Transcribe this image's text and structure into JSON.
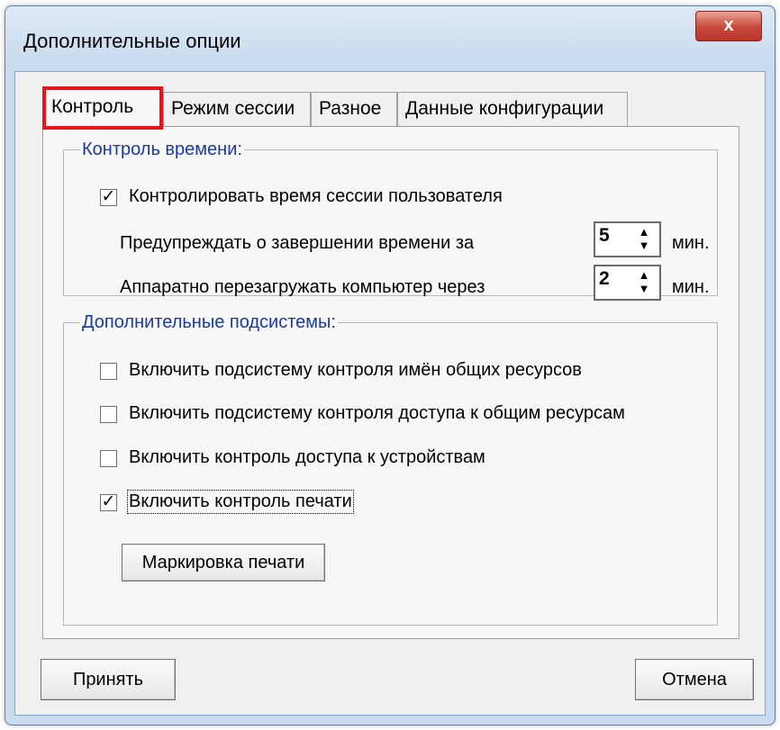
{
  "window": {
    "title": "Дополнительные опции",
    "close_label": "x"
  },
  "tabs": [
    {
      "label": "Контроль",
      "active": true
    },
    {
      "label": "Режим сессии",
      "active": false
    },
    {
      "label": "Разное",
      "active": false
    },
    {
      "label": "Данные конфигурации",
      "active": false
    }
  ],
  "time_control": {
    "legend": "Контроль времени:",
    "monitor_checkbox": {
      "label": "Контролировать время сессии пользователя",
      "checked": true,
      "mark": "✓"
    },
    "warn": {
      "label": "Предупреждать о завершении времени за",
      "value": "5",
      "unit": "мин."
    },
    "reboot": {
      "label": "Аппаратно перезагружать компьютер через",
      "value": "2",
      "unit": "мин."
    }
  },
  "subsystems": {
    "legend": "Дополнительные подсистемы:",
    "items": [
      {
        "label": "Включить подсистему контроля имён общих ресурсов",
        "checked": false,
        "mark": ""
      },
      {
        "label": "Включить подсистему контроля доступа к общим ресурсам",
        "checked": false,
        "mark": ""
      },
      {
        "label": "Включить контроль доступа к устройствам",
        "checked": false,
        "mark": ""
      },
      {
        "label": "Включить контроль печати",
        "checked": true,
        "mark": "✓"
      }
    ],
    "print_marking_button": "Маркировка печати"
  },
  "footer": {
    "accept_label": "Принять",
    "cancel_label": "Отмена"
  },
  "icons": {
    "spin_up": "▲",
    "spin_down": "▼"
  },
  "colors": {
    "active_tab_highlight": "#e3141b",
    "legend_text": "#1a3aa0",
    "close_button": "#c7473a"
  }
}
